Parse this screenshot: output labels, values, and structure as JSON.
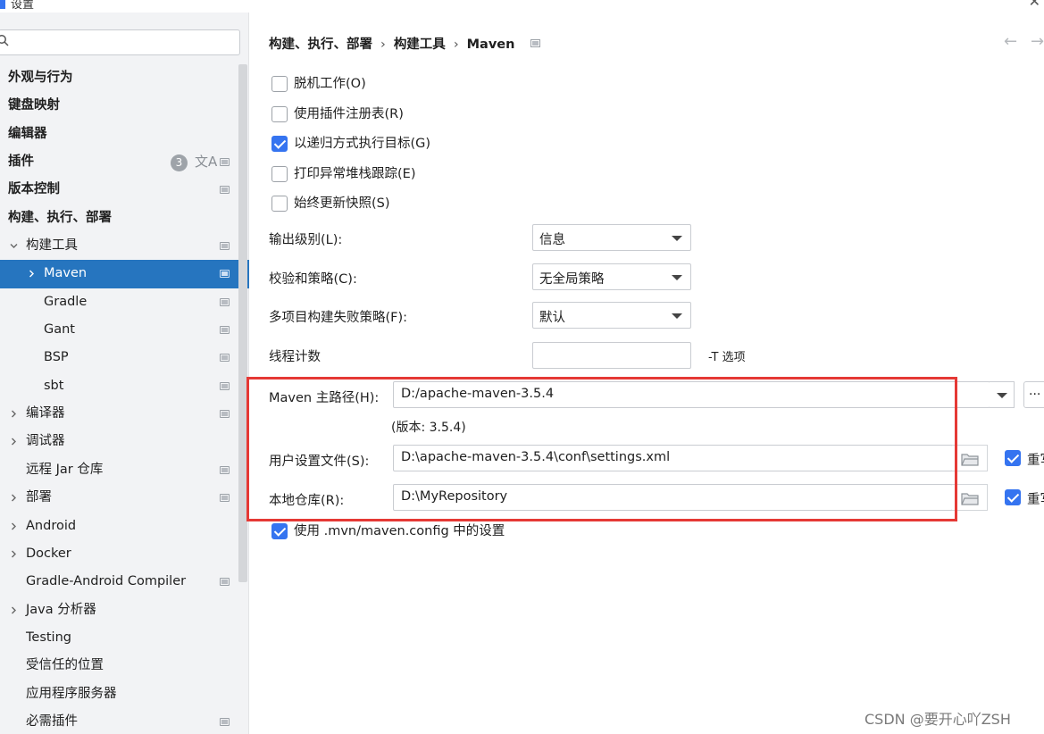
{
  "window": {
    "title": "设置",
    "close": "✕"
  },
  "search": {
    "placeholder": "",
    "icon": "search-icon"
  },
  "sidebar": {
    "items": [
      {
        "label": "外观与行为",
        "level": 0,
        "bold": true,
        "chevron": false,
        "icon": false
      },
      {
        "label": "键盘映射",
        "level": 0,
        "bold": true,
        "chevron": false,
        "icon": false
      },
      {
        "label": "编辑器",
        "level": 0,
        "bold": true,
        "chevron": false,
        "icon": false
      },
      {
        "label": "插件",
        "level": 0,
        "bold": true,
        "chevron": false,
        "icon": true,
        "badge": "3",
        "lang": "文A"
      },
      {
        "label": "版本控制",
        "level": 0,
        "bold": true,
        "chevron": false,
        "icon": true
      },
      {
        "label": "构建、执行、部署",
        "level": 0,
        "bold": true,
        "chevron": false,
        "icon": false
      },
      {
        "label": "构建工具",
        "level": 1,
        "chevron": "down",
        "icon": true
      },
      {
        "label": "Maven",
        "level": 2,
        "chevron": "right",
        "icon": true,
        "selected": true
      },
      {
        "label": "Gradle",
        "level": 2,
        "chevron": false,
        "icon": true
      },
      {
        "label": "Gant",
        "level": 2,
        "chevron": false,
        "icon": true
      },
      {
        "label": "BSP",
        "level": 2,
        "chevron": false,
        "icon": true
      },
      {
        "label": "sbt",
        "level": 2,
        "chevron": false,
        "icon": true
      },
      {
        "label": "编译器",
        "level": 1,
        "chevron": "right",
        "icon": true
      },
      {
        "label": "调试器",
        "level": 1,
        "chevron": "right",
        "icon": false
      },
      {
        "label": "远程 Jar 仓库",
        "level": 1,
        "chevron": false,
        "icon": true
      },
      {
        "label": "部署",
        "level": 1,
        "chevron": "right",
        "icon": true
      },
      {
        "label": "Android",
        "level": 1,
        "chevron": "right",
        "icon": false
      },
      {
        "label": "Docker",
        "level": 1,
        "chevron": "right",
        "icon": false
      },
      {
        "label": "Gradle-Android Compiler",
        "level": 1,
        "chevron": false,
        "icon": true
      },
      {
        "label": "Java 分析器",
        "level": 1,
        "chevron": "right",
        "icon": false
      },
      {
        "label": "Testing",
        "level": 1,
        "chevron": false,
        "icon": false
      },
      {
        "label": "受信任的位置",
        "level": 1,
        "chevron": false,
        "icon": false
      },
      {
        "label": "应用程序服务器",
        "level": 1,
        "chevron": false,
        "icon": false
      },
      {
        "label": "必需插件",
        "level": 1,
        "chevron": false,
        "icon": true
      }
    ]
  },
  "breadcrumb": {
    "part1": "构建、执行、部署",
    "part2": "构建工具",
    "part3": "Maven",
    "sep": "›"
  },
  "nav": {
    "back": "←",
    "forward": "→"
  },
  "checkboxes": [
    {
      "label": "脱机工作(O)",
      "checked": false
    },
    {
      "label": "使用插件注册表(R)",
      "checked": false
    },
    {
      "label": "以递归方式执行目标(G)",
      "checked": true
    },
    {
      "label": "打印异常堆栈跟踪(E)",
      "checked": false
    },
    {
      "label": "始终更新快照(S)",
      "checked": false
    }
  ],
  "fields": {
    "output_level_label": "输出级别(L):",
    "output_level_value": "信息",
    "checksum_label": "校验和策略(C):",
    "checksum_value": "无全局策略",
    "failure_label": "多项目构建失败策略(F):",
    "failure_value": "默认",
    "threads_label": "线程计数",
    "threads_value": "",
    "threads_note": "-T 选项",
    "maven_home_label": "Maven 主路径(H):",
    "maven_home_value": "D:/apache-maven-3.5.4",
    "more_label": "...",
    "version": "(版本: 3.5.4)",
    "user_settings_label": "用户设置文件(S):",
    "user_settings_value": "D:\\apache-maven-3.5.4\\conf\\settings.xml",
    "override_label": "重写",
    "local_repo_label": "本地仓库(R):",
    "local_repo_value": "D:\\MyRepository",
    "use_mvn_config_label": "使用 .mvn/maven.config 中的设置"
  },
  "watermark": "CSDN @要开心吖ZSH",
  "colors": {
    "accent": "#3574f0",
    "selection": "#2675bf",
    "highlight": "#e53935"
  }
}
